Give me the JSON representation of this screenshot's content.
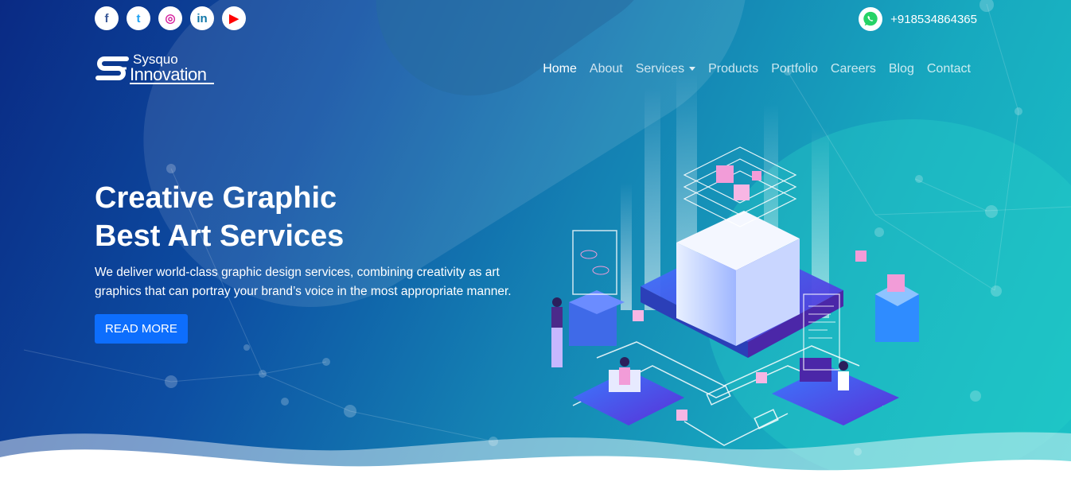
{
  "topbar": {
    "social": [
      {
        "name": "facebook-icon",
        "glyph": "f",
        "color": "#3b5998"
      },
      {
        "name": "twitter-icon",
        "glyph": "t",
        "color": "#1da1f2"
      },
      {
        "name": "instagram-icon",
        "glyph": "◎",
        "color": "#d6249f"
      },
      {
        "name": "linkedin-icon",
        "glyph": "in",
        "color": "#0e76a8"
      },
      {
        "name": "youtube-icon",
        "glyph": "▶",
        "color": "#ff0000"
      }
    ],
    "phone": "+918534864365"
  },
  "logo": {
    "line1": "Sysquo",
    "line2": "Innovation"
  },
  "nav": {
    "home": "Home",
    "about": "About",
    "services": "Services",
    "products": "Products",
    "portfolio": "Portfolio",
    "careers": "Careers",
    "blog": "Blog",
    "contact": "Contact"
  },
  "hero": {
    "title_line1": "Creative Graphic",
    "title_line2": "Best Art Services",
    "description": "We deliver world-class graphic design services, combining creativity as art graphics that can portray your brand’s voice in the most appropriate manner.",
    "button": "READ MORE"
  },
  "colors": {
    "accent": "#0d6efd",
    "whatsapp": "#25d366"
  }
}
